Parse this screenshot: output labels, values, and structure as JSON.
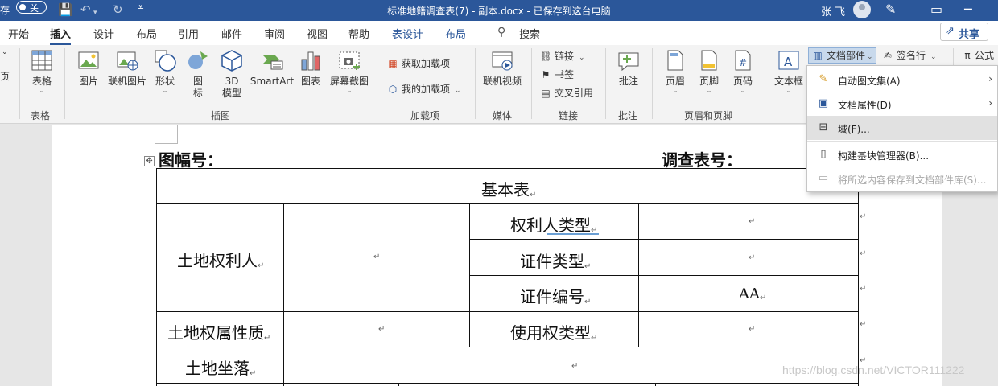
{
  "titlebar": {
    "autosave_label": "存",
    "toggle_label": "关",
    "doc_title": "标准地籍调查表(7) - 副本.docx - 已保存到这台电脑",
    "user_name": "张 飞"
  },
  "tabs": [
    "开始",
    "插入",
    "设计",
    "布局",
    "引用",
    "邮件",
    "审阅",
    "视图",
    "帮助",
    "表设计",
    "布局",
    "搜索"
  ],
  "share_label": "共享",
  "ribbon": {
    "page_stub": "页",
    "table": {
      "label": "表格",
      "group": "表格"
    },
    "illustrations": {
      "picture": "图片",
      "online_picture": "联机图片",
      "shapes": "形状",
      "icons": [
        "图",
        "标"
      ],
      "model3d": [
        "3D",
        "模型"
      ],
      "smartart": "SmartArt",
      "chart": "图表",
      "screenshot": "屏幕截图",
      "group": "插图"
    },
    "addins": {
      "get": "获取加载项",
      "mine": "我的加载项",
      "group": "加载项"
    },
    "media": {
      "video": "联机视频",
      "group": "媒体"
    },
    "links": {
      "link": "链接",
      "bookmark": "书签",
      "crossref": "交叉引用",
      "group": "链接"
    },
    "comments": {
      "comment": "批注",
      "group": "批注"
    },
    "header_footer": {
      "header": "页眉",
      "footer": "页脚",
      "page_number": "页码",
      "group": "页眉和页脚"
    },
    "text": {
      "textbox": "文本框",
      "quick_parts": "文档部件",
      "signature": "签名行",
      "equation": "公式"
    }
  },
  "dropdown": {
    "items": [
      {
        "label": "自动图文集(A)",
        "submenu": true,
        "disabled": false
      },
      {
        "label": "文档属性(D)",
        "submenu": true,
        "disabled": false
      },
      {
        "label": "域(F)...",
        "submenu": false,
        "disabled": false
      },
      {
        "label": "构建基块管理器(B)...",
        "submenu": false,
        "disabled": false
      },
      {
        "label": "将所选内容保存到文档部件库(S)...",
        "submenu": false,
        "disabled": true
      }
    ]
  },
  "document": {
    "map_no": "图幅号：",
    "survey_no": "调查表号：",
    "basic_table": "基本表",
    "land_owner": "土地权利人",
    "owner_type": "权利人类型",
    "cert_type": "证件类型",
    "cert_no": "证件编号",
    "cert_no_value": "AA",
    "ownership": "土地权属性质",
    "use_type": "使用权类型",
    "location": "土地坐落"
  },
  "watermark": "https://blog.csdn.net/VICTOR111222"
}
